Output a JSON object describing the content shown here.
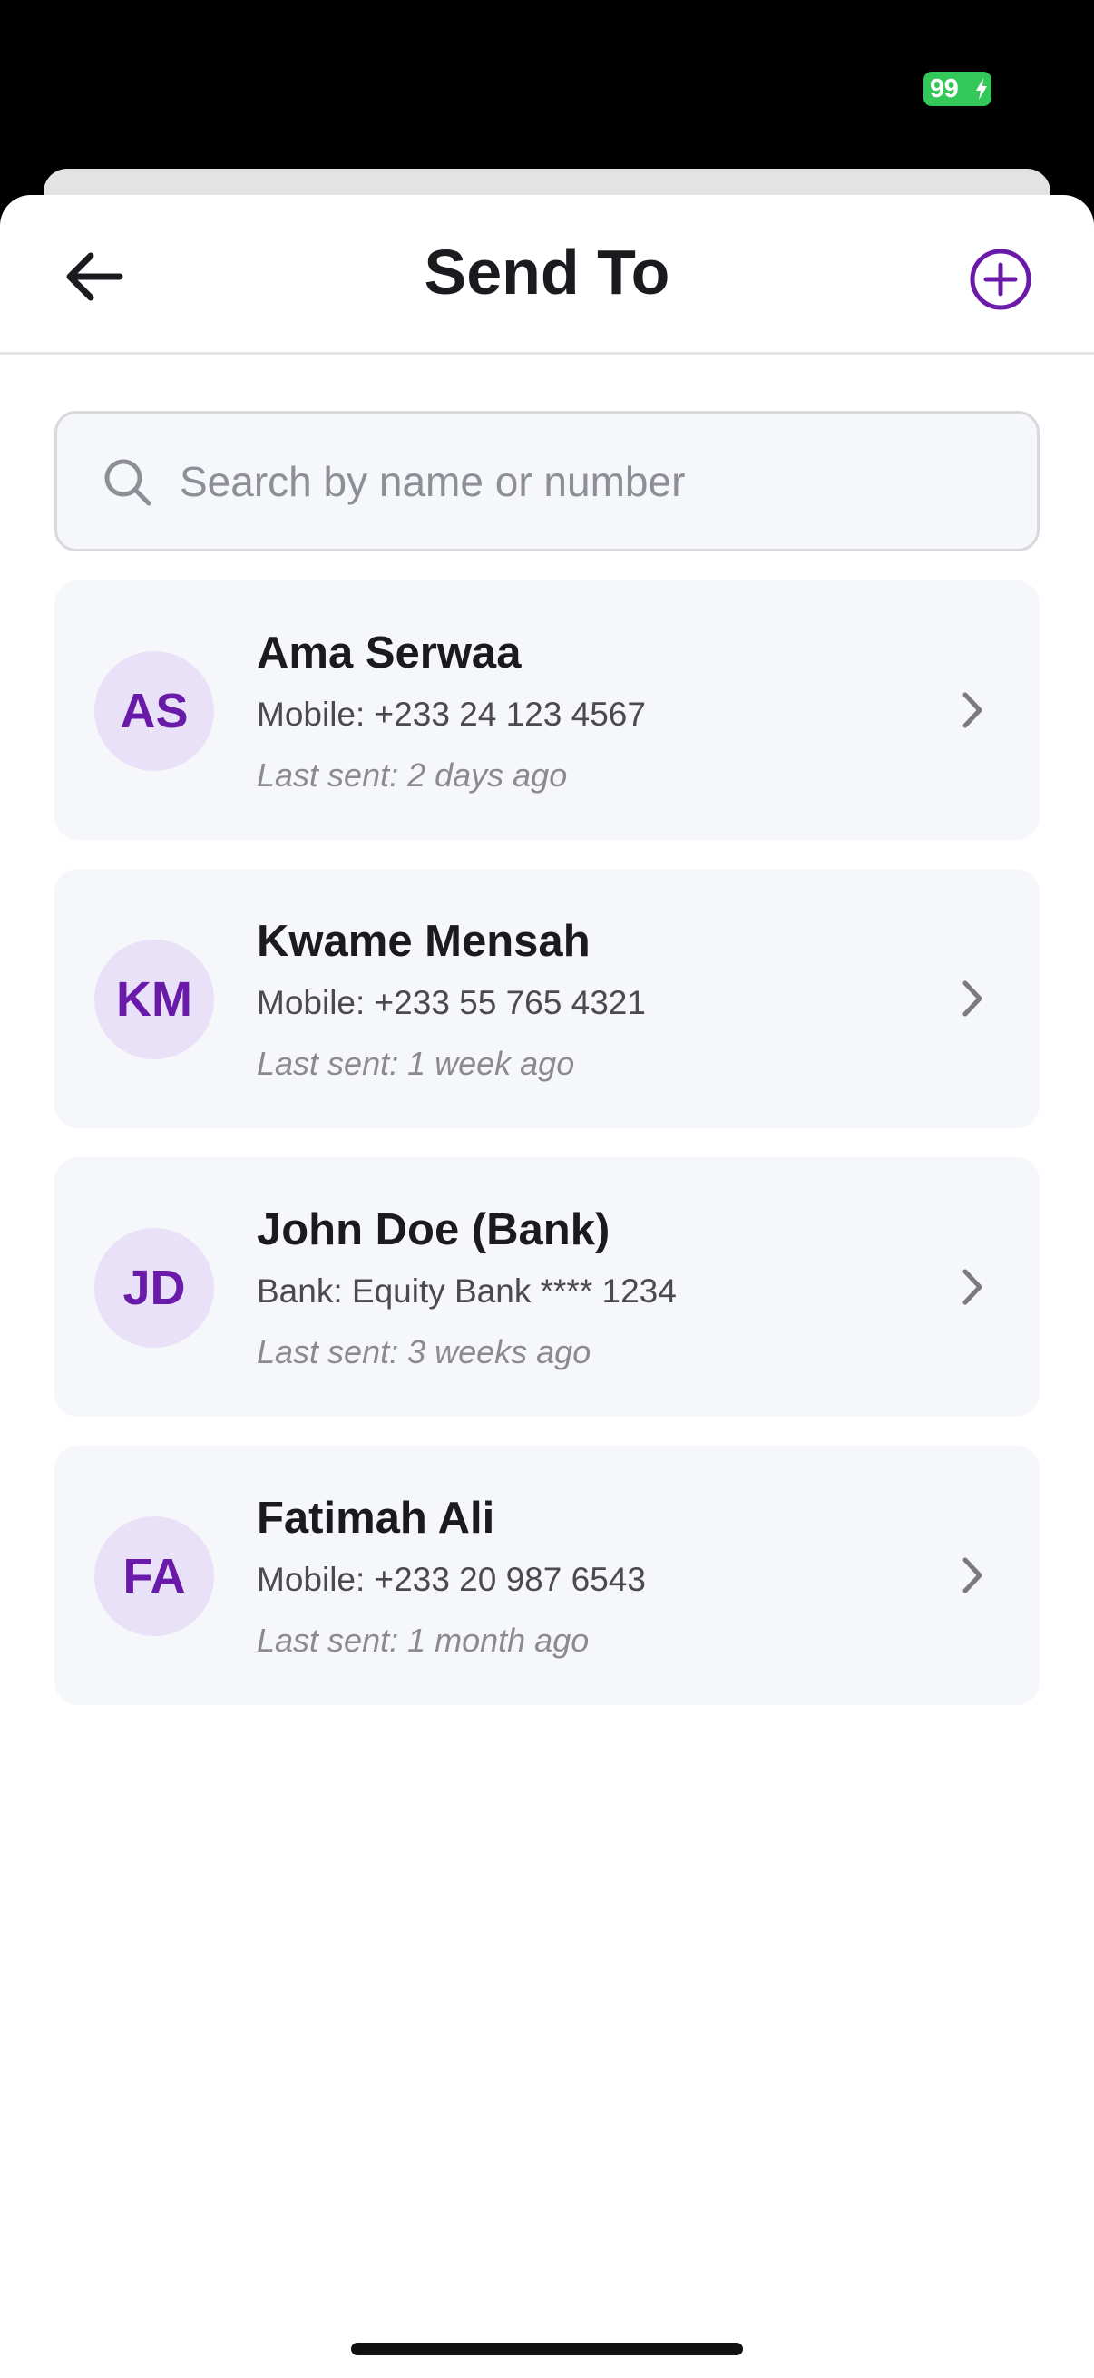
{
  "status_bar": {
    "battery_level": "99",
    "battery_color": "#34c759"
  },
  "header": {
    "title": "Send To",
    "back_icon": "arrow-left-icon",
    "add_icon": "plus-circle-icon",
    "accent_color": "#6a1aa8"
  },
  "search": {
    "placeholder": "Search by name or number",
    "value": "",
    "icon": "search-icon"
  },
  "contacts": [
    {
      "initials": "AS",
      "name": "Ama Serwaa",
      "detail": "Mobile: +233 24 123 4567",
      "last_sent": "Last sent: 2 days ago"
    },
    {
      "initials": "KM",
      "name": "Kwame Mensah",
      "detail": "Mobile: +233 55 765 4321",
      "last_sent": "Last sent: 1 week ago"
    },
    {
      "initials": "JD",
      "name": "John Doe (Bank)",
      "detail": "Bank: Equity Bank **** 1234",
      "last_sent": "Last sent: 3 weeks ago"
    },
    {
      "initials": "FA",
      "name": "Fatimah Ali",
      "detail": "Mobile: +233 20 987 6543",
      "last_sent": "Last sent: 1 month ago"
    }
  ]
}
